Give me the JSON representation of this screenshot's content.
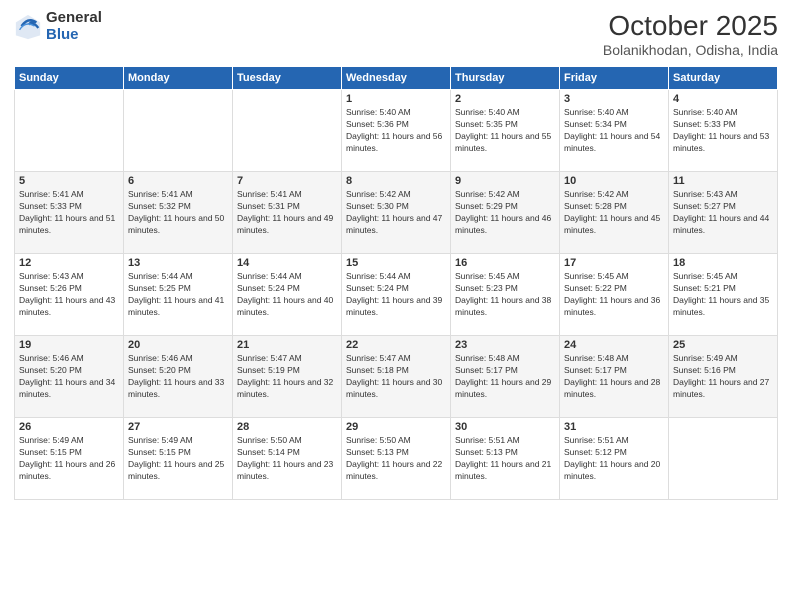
{
  "logo": {
    "general": "General",
    "blue": "Blue"
  },
  "header": {
    "month": "October 2025",
    "location": "Bolanikhodan, Odisha, India"
  },
  "weekdays": [
    "Sunday",
    "Monday",
    "Tuesday",
    "Wednesday",
    "Thursday",
    "Friday",
    "Saturday"
  ],
  "weeks": [
    [
      {
        "day": "",
        "sunrise": "",
        "sunset": "",
        "daylight": ""
      },
      {
        "day": "",
        "sunrise": "",
        "sunset": "",
        "daylight": ""
      },
      {
        "day": "",
        "sunrise": "",
        "sunset": "",
        "daylight": ""
      },
      {
        "day": "1",
        "sunrise": "Sunrise: 5:40 AM",
        "sunset": "Sunset: 5:36 PM",
        "daylight": "Daylight: 11 hours and 56 minutes."
      },
      {
        "day": "2",
        "sunrise": "Sunrise: 5:40 AM",
        "sunset": "Sunset: 5:35 PM",
        "daylight": "Daylight: 11 hours and 55 minutes."
      },
      {
        "day": "3",
        "sunrise": "Sunrise: 5:40 AM",
        "sunset": "Sunset: 5:34 PM",
        "daylight": "Daylight: 11 hours and 54 minutes."
      },
      {
        "day": "4",
        "sunrise": "Sunrise: 5:40 AM",
        "sunset": "Sunset: 5:33 PM",
        "daylight": "Daylight: 11 hours and 53 minutes."
      }
    ],
    [
      {
        "day": "5",
        "sunrise": "Sunrise: 5:41 AM",
        "sunset": "Sunset: 5:33 PM",
        "daylight": "Daylight: 11 hours and 51 minutes."
      },
      {
        "day": "6",
        "sunrise": "Sunrise: 5:41 AM",
        "sunset": "Sunset: 5:32 PM",
        "daylight": "Daylight: 11 hours and 50 minutes."
      },
      {
        "day": "7",
        "sunrise": "Sunrise: 5:41 AM",
        "sunset": "Sunset: 5:31 PM",
        "daylight": "Daylight: 11 hours and 49 minutes."
      },
      {
        "day": "8",
        "sunrise": "Sunrise: 5:42 AM",
        "sunset": "Sunset: 5:30 PM",
        "daylight": "Daylight: 11 hours and 47 minutes."
      },
      {
        "day": "9",
        "sunrise": "Sunrise: 5:42 AM",
        "sunset": "Sunset: 5:29 PM",
        "daylight": "Daylight: 11 hours and 46 minutes."
      },
      {
        "day": "10",
        "sunrise": "Sunrise: 5:42 AM",
        "sunset": "Sunset: 5:28 PM",
        "daylight": "Daylight: 11 hours and 45 minutes."
      },
      {
        "day": "11",
        "sunrise": "Sunrise: 5:43 AM",
        "sunset": "Sunset: 5:27 PM",
        "daylight": "Daylight: 11 hours and 44 minutes."
      }
    ],
    [
      {
        "day": "12",
        "sunrise": "Sunrise: 5:43 AM",
        "sunset": "Sunset: 5:26 PM",
        "daylight": "Daylight: 11 hours and 43 minutes."
      },
      {
        "day": "13",
        "sunrise": "Sunrise: 5:44 AM",
        "sunset": "Sunset: 5:25 PM",
        "daylight": "Daylight: 11 hours and 41 minutes."
      },
      {
        "day": "14",
        "sunrise": "Sunrise: 5:44 AM",
        "sunset": "Sunset: 5:24 PM",
        "daylight": "Daylight: 11 hours and 40 minutes."
      },
      {
        "day": "15",
        "sunrise": "Sunrise: 5:44 AM",
        "sunset": "Sunset: 5:24 PM",
        "daylight": "Daylight: 11 hours and 39 minutes."
      },
      {
        "day": "16",
        "sunrise": "Sunrise: 5:45 AM",
        "sunset": "Sunset: 5:23 PM",
        "daylight": "Daylight: 11 hours and 38 minutes."
      },
      {
        "day": "17",
        "sunrise": "Sunrise: 5:45 AM",
        "sunset": "Sunset: 5:22 PM",
        "daylight": "Daylight: 11 hours and 36 minutes."
      },
      {
        "day": "18",
        "sunrise": "Sunrise: 5:45 AM",
        "sunset": "Sunset: 5:21 PM",
        "daylight": "Daylight: 11 hours and 35 minutes."
      }
    ],
    [
      {
        "day": "19",
        "sunrise": "Sunrise: 5:46 AM",
        "sunset": "Sunset: 5:20 PM",
        "daylight": "Daylight: 11 hours and 34 minutes."
      },
      {
        "day": "20",
        "sunrise": "Sunrise: 5:46 AM",
        "sunset": "Sunset: 5:20 PM",
        "daylight": "Daylight: 11 hours and 33 minutes."
      },
      {
        "day": "21",
        "sunrise": "Sunrise: 5:47 AM",
        "sunset": "Sunset: 5:19 PM",
        "daylight": "Daylight: 11 hours and 32 minutes."
      },
      {
        "day": "22",
        "sunrise": "Sunrise: 5:47 AM",
        "sunset": "Sunset: 5:18 PM",
        "daylight": "Daylight: 11 hours and 30 minutes."
      },
      {
        "day": "23",
        "sunrise": "Sunrise: 5:48 AM",
        "sunset": "Sunset: 5:17 PM",
        "daylight": "Daylight: 11 hours and 29 minutes."
      },
      {
        "day": "24",
        "sunrise": "Sunrise: 5:48 AM",
        "sunset": "Sunset: 5:17 PM",
        "daylight": "Daylight: 11 hours and 28 minutes."
      },
      {
        "day": "25",
        "sunrise": "Sunrise: 5:49 AM",
        "sunset": "Sunset: 5:16 PM",
        "daylight": "Daylight: 11 hours and 27 minutes."
      }
    ],
    [
      {
        "day": "26",
        "sunrise": "Sunrise: 5:49 AM",
        "sunset": "Sunset: 5:15 PM",
        "daylight": "Daylight: 11 hours and 26 minutes."
      },
      {
        "day": "27",
        "sunrise": "Sunrise: 5:49 AM",
        "sunset": "Sunset: 5:15 PM",
        "daylight": "Daylight: 11 hours and 25 minutes."
      },
      {
        "day": "28",
        "sunrise": "Sunrise: 5:50 AM",
        "sunset": "Sunset: 5:14 PM",
        "daylight": "Daylight: 11 hours and 23 minutes."
      },
      {
        "day": "29",
        "sunrise": "Sunrise: 5:50 AM",
        "sunset": "Sunset: 5:13 PM",
        "daylight": "Daylight: 11 hours and 22 minutes."
      },
      {
        "day": "30",
        "sunrise": "Sunrise: 5:51 AM",
        "sunset": "Sunset: 5:13 PM",
        "daylight": "Daylight: 11 hours and 21 minutes."
      },
      {
        "day": "31",
        "sunrise": "Sunrise: 5:51 AM",
        "sunset": "Sunset: 5:12 PM",
        "daylight": "Daylight: 11 hours and 20 minutes."
      },
      {
        "day": "",
        "sunrise": "",
        "sunset": "",
        "daylight": ""
      }
    ]
  ]
}
